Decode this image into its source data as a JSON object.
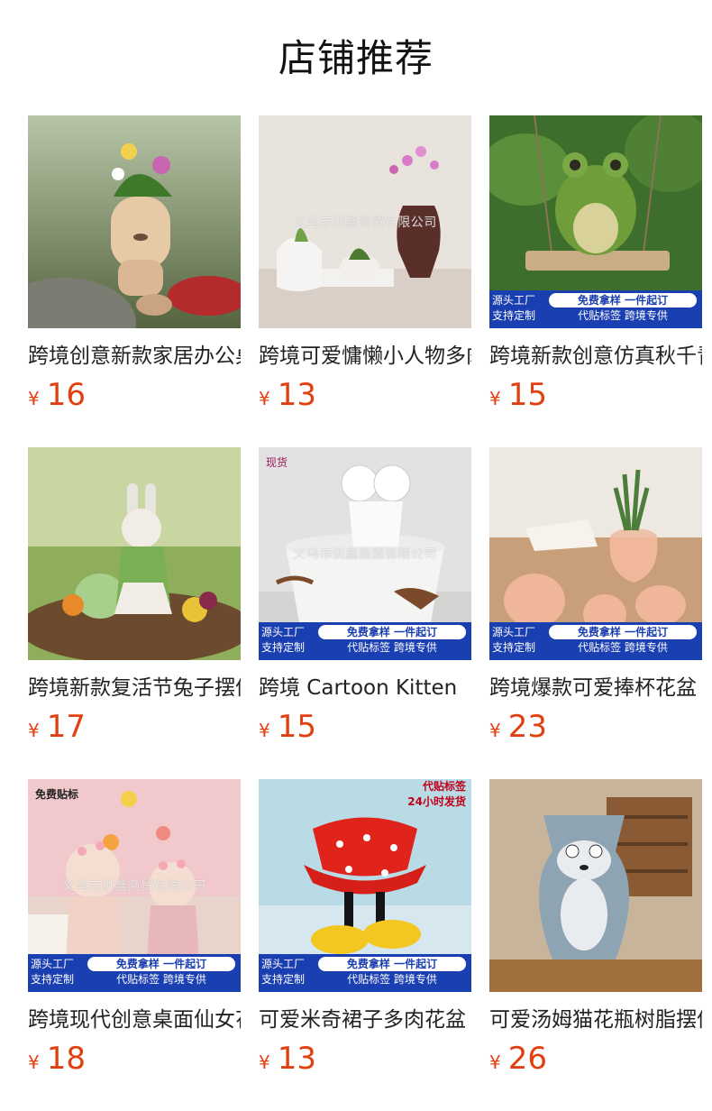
{
  "page_title": "店铺推荐",
  "products": [
    {
      "name": "跨境创意新款家居办公桌面",
      "currency": "¥",
      "price": "16",
      "watermark": "",
      "tag_top_left": "",
      "tag_top_right": [],
      "banner": null
    },
    {
      "name": "跨境可爱慵懒小人物多肉花盆",
      "currency": "¥",
      "price": "13",
      "watermark": "义乌市洪鑫商贸有限公司",
      "tag_top_left": "",
      "tag_top_right": [],
      "banner": null
    },
    {
      "name": "跨境新款创意仿真秋千青蛙",
      "currency": "¥",
      "price": "15",
      "watermark": "",
      "tag_top_left": "",
      "tag_top_right": [],
      "banner": {
        "left1": "源头工厂",
        "left2": "支持定制",
        "pill": "免费拿样  一件起订",
        "sub": "代贴标签  跨境专供"
      }
    },
    {
      "name": "跨境新款复活节兔子摆件",
      "currency": "¥",
      "price": "17",
      "watermark": "",
      "tag_top_left": "",
      "tag_top_right": [],
      "banner": null
    },
    {
      "name": "跨境 Cartoon Kitten",
      "currency": "¥",
      "price": "15",
      "watermark": "义乌市洪鑫商贸有限公司",
      "tag_top_left": "现货",
      "tag_top_right": [],
      "banner": {
        "left1": "源头工厂",
        "left2": "支持定制",
        "pill": "免费拿样  一件起订",
        "sub": "代贴标签  跨境专供"
      }
    },
    {
      "name": "跨境爆款可爱捧杯花盆",
      "currency": "¥",
      "price": "23",
      "watermark": "",
      "tag_top_left": "",
      "tag_top_right": [],
      "banner": {
        "left1": "源头工厂",
        "left2": "支持定制",
        "pill": "免费拿样  一件起订",
        "sub": "代贴标签  跨境专供"
      }
    },
    {
      "name": "跨境现代创意桌面仙女花盆",
      "currency": "¥",
      "price": "18",
      "watermark": "义乌市洪鑫商贸有限公司",
      "tag_top_left": "免费贴标",
      "tag_top_right": [],
      "banner": {
        "left1": "源头工厂",
        "left2": "支持定制",
        "pill": "免费拿样  一件起订",
        "sub": "代贴标签  跨境专供"
      }
    },
    {
      "name": "可爱米奇裙子多肉花盆",
      "currency": "¥",
      "price": "13",
      "watermark": "",
      "tag_top_left": "",
      "tag_top_right": [
        "代贴标签",
        "24小时发货"
      ],
      "banner": {
        "left1": "源头工厂",
        "left2": "支持定制",
        "pill": "免费拿样  一件起订",
        "sub": "代贴标签  跨境专供"
      }
    },
    {
      "name": "可爱汤姆猫花瓶树脂摆件",
      "currency": "¥",
      "price": "26",
      "watermark": "",
      "tag_top_left": "",
      "tag_top_right": [],
      "banner": null
    }
  ]
}
